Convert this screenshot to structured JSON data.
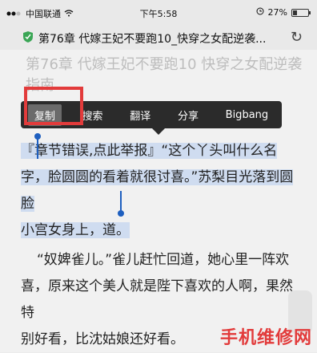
{
  "status": {
    "carrier": "中国联通",
    "time": "下午5:58",
    "battery": "27%",
    "battery_level": 0.27
  },
  "browser": {
    "title": "第76章 代嫁王妃不要跑10_快穿之女配逆袭..."
  },
  "chapter": {
    "title": "第76章 代嫁王妃不要跑10 快穿之女配逆袭指南"
  },
  "menu": {
    "copy": "复制",
    "search": "搜索",
    "translate": "翻译",
    "share": "分享",
    "bigbang": "Bigbang"
  },
  "paragraph1": {
    "line1": "『章节错误,点此举报』“这个丫头叫什么名",
    "line2": "字，脸圆圆的看着就很讨喜。”苏梨目光落到圆脸",
    "line3": "小宫女身上，道。"
  },
  "paragraph2": {
    "line1": "“奴婢雀儿。”雀儿赶忙回道，她心里一阵欢",
    "line2": "喜，原来这个美人就是陛下喜欢的人啊，果然特",
    "line3": "别好看，比沈姑娘还好看。"
  },
  "watermark": "手机维修网",
  "colors": {
    "highlight_border": "#e23b3b",
    "selection_bg": "#cfdcf0",
    "handle": "#1e5fbf",
    "menu_bg": "#2b2b2b"
  }
}
